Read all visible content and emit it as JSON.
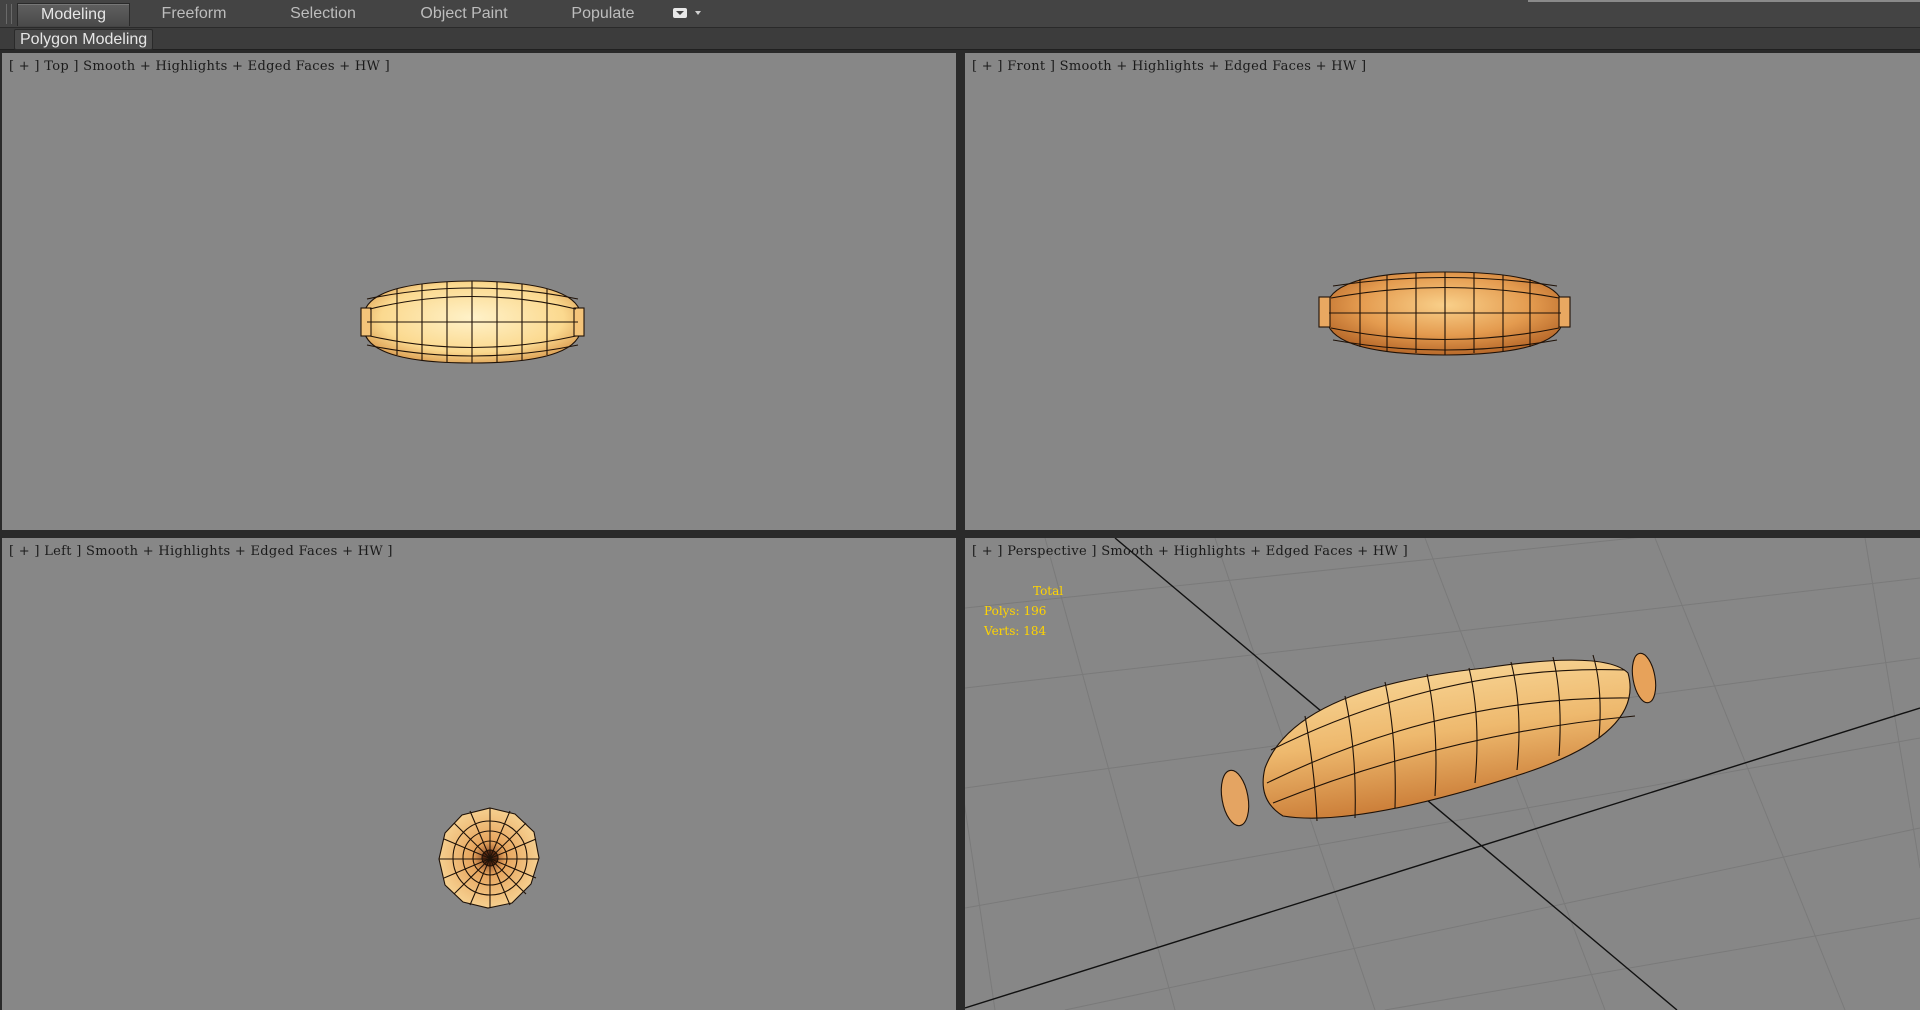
{
  "ribbon": {
    "tabs": [
      "Modeling",
      "Freeform",
      "Selection",
      "Object Paint",
      "Populate"
    ],
    "active_tab": "Modeling",
    "panel_label": "Polygon Modeling"
  },
  "viewports": {
    "top": {
      "label": "[ + ] Top ] Smooth + Highlights + Edged Faces + HW ]"
    },
    "front": {
      "label": "[ + ] Front ] Smooth + Highlights + Edged Faces + HW ]"
    },
    "left": {
      "label": "[ + ] Left ] Smooth + Highlights + Edged Faces + HW ]"
    },
    "perspective": {
      "label": "[ + ] Perspective ] Smooth + Highlights + Edged Faces + HW ]"
    }
  },
  "stats": {
    "total_label": "Total",
    "polys": "Polys: 196",
    "verts": "Verts: 184"
  },
  "colors": {
    "viewport_bg": "#878787",
    "ui_bg": "#444444",
    "stats_text": "#ffd400",
    "model_light": "#fde0a6",
    "model_dark": "#c97a35"
  },
  "icons": {
    "ribbon_extra": "minimize-ribbon-icon"
  }
}
